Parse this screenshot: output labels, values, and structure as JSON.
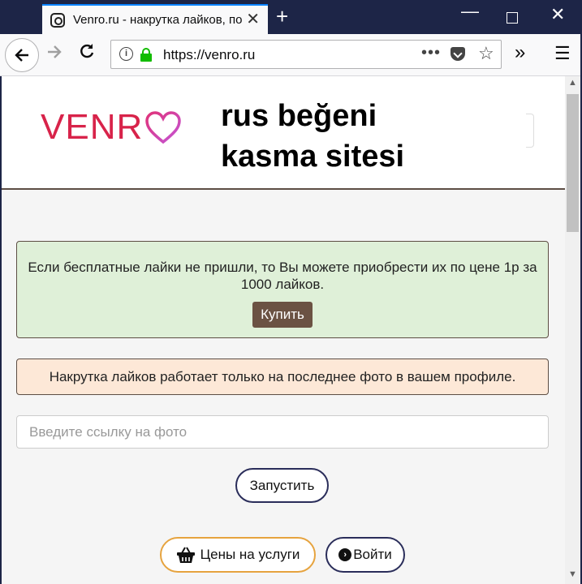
{
  "browser": {
    "tab_title": "Venro.ru - накрутка лайков, по",
    "tab_close": "✕",
    "new_tab": "+",
    "url": "https://venro.ru",
    "url_more": "•••",
    "icons": [
      "instagram-favicon-icon",
      "back-icon",
      "forward-icon",
      "reload-icon",
      "info-icon",
      "lock-icon",
      "pocket-icon",
      "bookmark-star-icon",
      "overflow-icon",
      "menu-icon"
    ]
  },
  "header": {
    "logo_text": "VENR",
    "caption": "rus beğeni kasma sitesi"
  },
  "notice_green": {
    "text": "Если бесплатные лайки не пришли, то Вы можете приобрести их по цене 1р за 1000 лайков.",
    "buy_label": "Купить"
  },
  "notice_orange": {
    "text": "Накрутка лайков работает только на последнее фото в вашем профиле."
  },
  "photo_link": {
    "placeholder": "Введите ссылку на фото",
    "value": ""
  },
  "start_label": "Запустить",
  "footer_buttons": {
    "prices_label": "Цены на услуги",
    "login_label": "Войти"
  },
  "colors": {
    "accent_brown": "#6b5243",
    "logo_red": "#d8234a",
    "prices_border": "#e6a33e",
    "navy_border": "#2a2d5a"
  }
}
